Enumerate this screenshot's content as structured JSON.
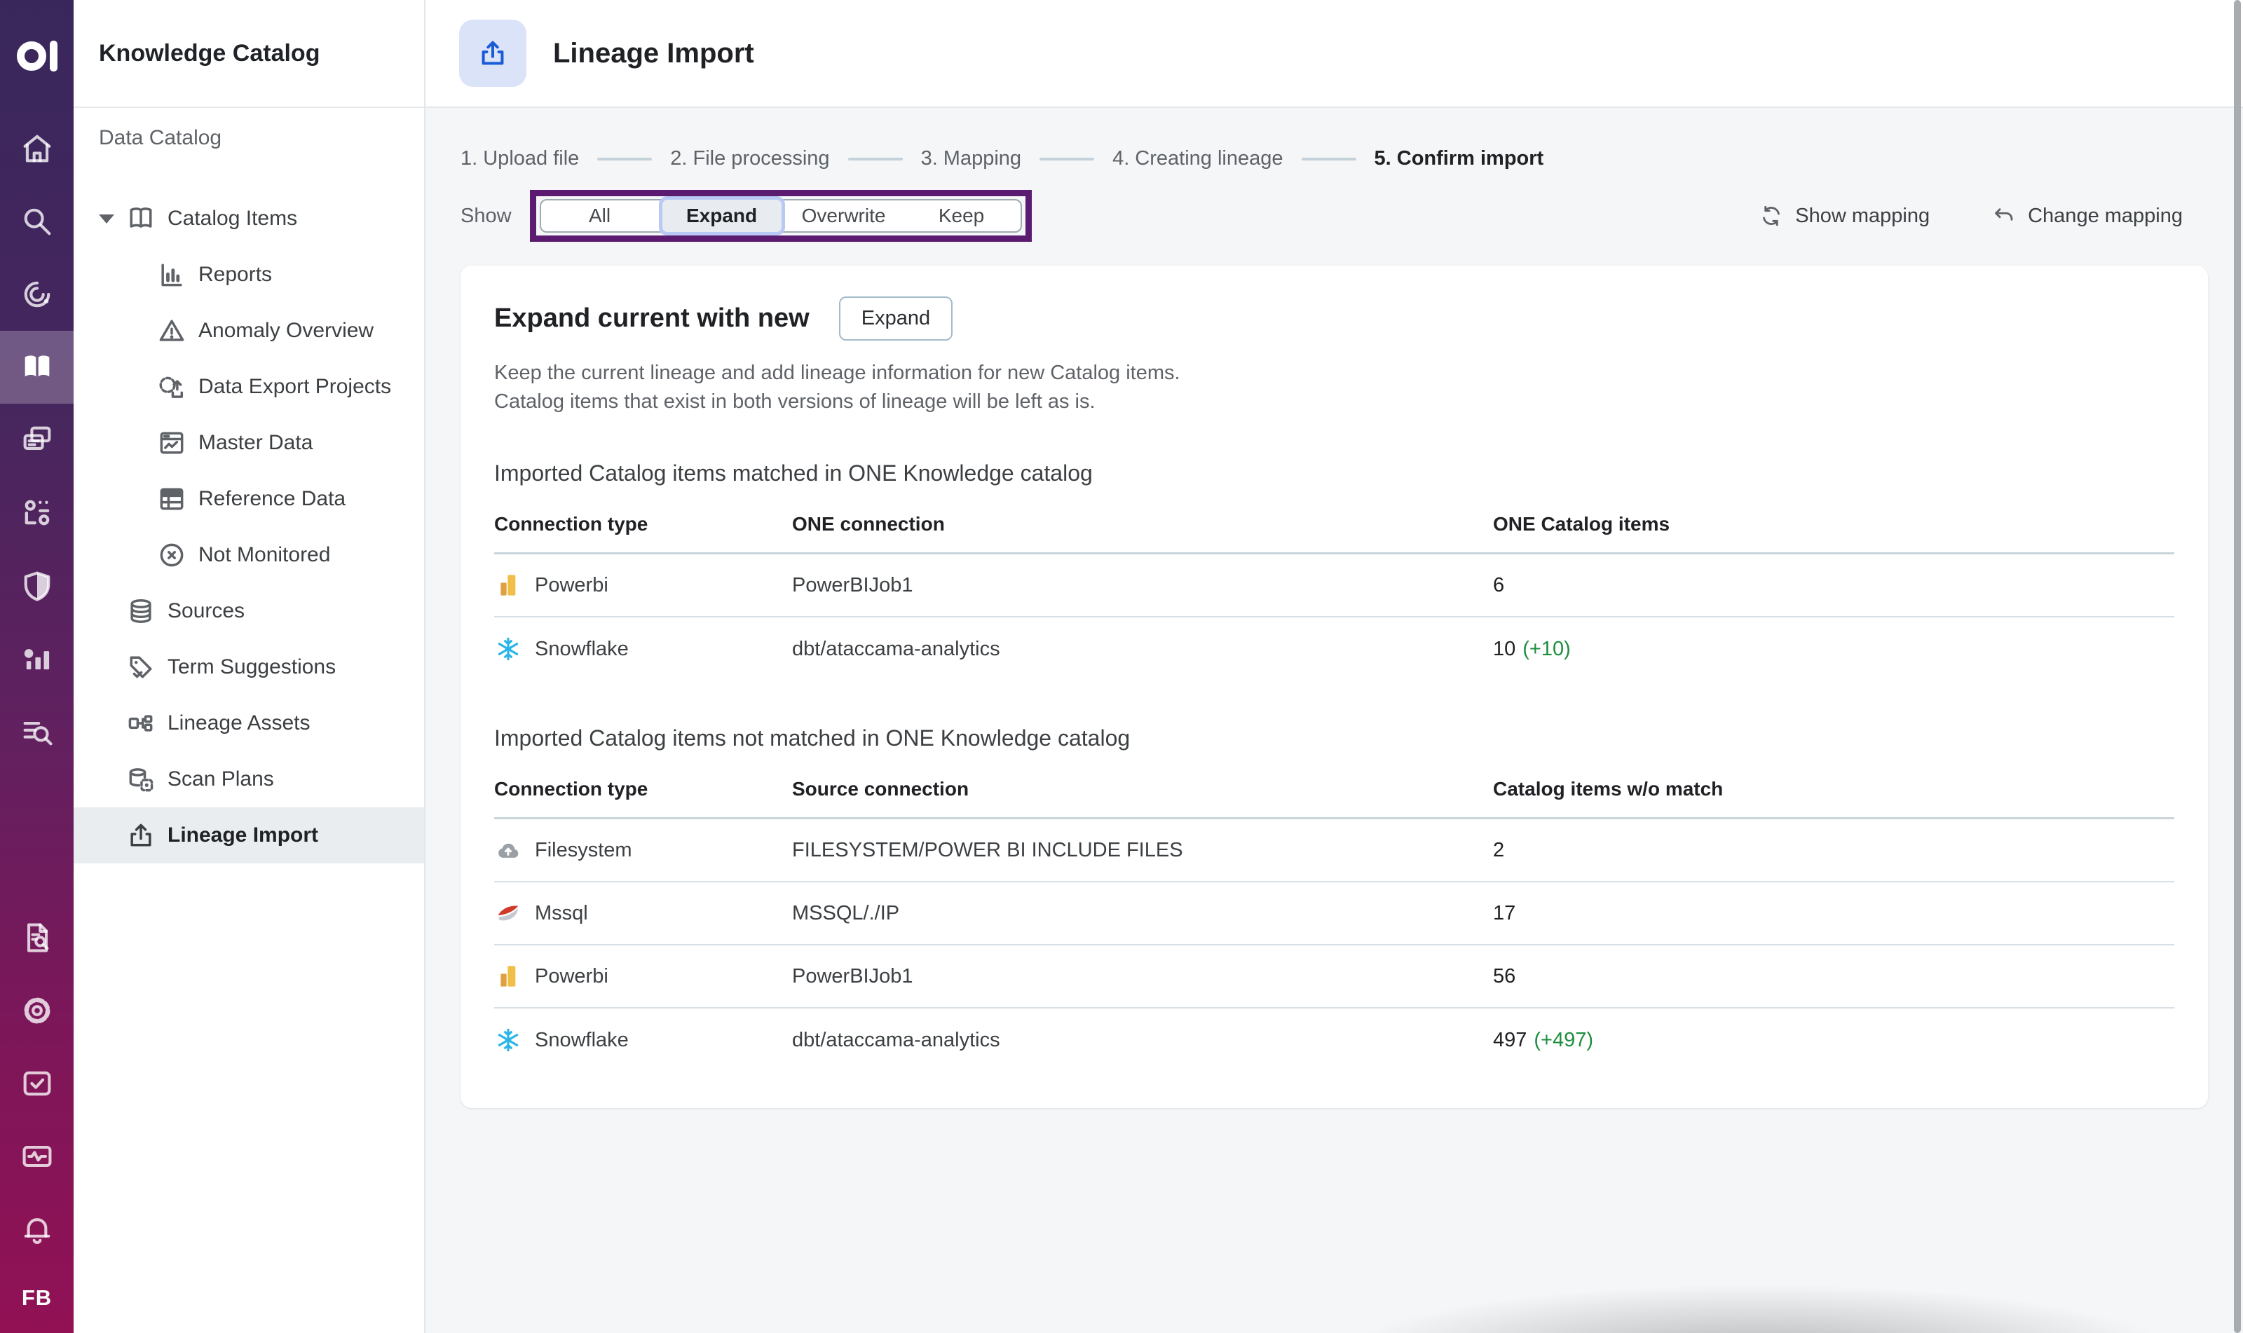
{
  "product": {
    "name": "Knowledge Catalog",
    "avatar": "FB"
  },
  "rail": {
    "items_top": [
      {
        "icon": "home-icon"
      },
      {
        "icon": "search-icon"
      },
      {
        "icon": "data-quality-icon"
      },
      {
        "icon": "knowledge-catalog-icon",
        "active": true
      },
      {
        "icon": "projects-icon"
      },
      {
        "icon": "data-stories-icon"
      },
      {
        "icon": "governance-shield-icon"
      },
      {
        "icon": "insights-icon"
      },
      {
        "icon": "data-discovery-icon"
      }
    ],
    "items_bottom": [
      {
        "icon": "audit-icon"
      },
      {
        "icon": "settings-gear-icon"
      },
      {
        "icon": "tasks-icon"
      },
      {
        "icon": "monitoring-icon"
      },
      {
        "icon": "notifications-bell-icon"
      }
    ]
  },
  "sidebar": {
    "title": "Knowledge Catalog",
    "section": "Data Catalog",
    "items": [
      {
        "label": "Catalog Items",
        "icon": "catalog-items-icon",
        "caret": true
      },
      {
        "label": "Reports",
        "icon": "reports-icon",
        "child": true
      },
      {
        "label": "Anomaly Overview",
        "icon": "anomaly-overview-icon",
        "child": true
      },
      {
        "label": "Data Export Projects",
        "icon": "data-export-projects-icon",
        "child": true
      },
      {
        "label": "Master Data",
        "icon": "master-data-icon",
        "child": true
      },
      {
        "label": "Reference Data",
        "icon": "reference-data-icon",
        "child": true
      },
      {
        "label": "Not Monitored",
        "icon": "not-monitored-icon",
        "child": true
      },
      {
        "label": "Sources",
        "icon": "sources-icon"
      },
      {
        "label": "Term Suggestions",
        "icon": "term-suggestions-icon"
      },
      {
        "label": "Lineage Assets",
        "icon": "lineage-assets-icon"
      },
      {
        "label": "Scan Plans",
        "icon": "scan-plans-icon"
      },
      {
        "label": "Lineage Import",
        "icon": "lineage-import-icon",
        "active": true
      }
    ]
  },
  "header": {
    "title": "Lineage Import"
  },
  "steps": [
    {
      "label": "1. Upload file"
    },
    {
      "label": "2. File processing"
    },
    {
      "label": "3. Mapping"
    },
    {
      "label": "4. Creating lineage"
    },
    {
      "label": "5. Confirm import",
      "active": true
    }
  ],
  "show_filter": {
    "label": "Show",
    "options": [
      {
        "label": "All"
      },
      {
        "label": "Expand",
        "selected": true
      },
      {
        "label": "Overwrite"
      },
      {
        "label": "Keep"
      }
    ]
  },
  "toolbar": {
    "show_mapping": "Show mapping",
    "change_mapping": "Change mapping"
  },
  "panel": {
    "title": "Expand current with new",
    "action": "Expand",
    "description_line1": "Keep the current lineage and add lineage information for new Catalog items.",
    "description_line2": "Catalog items that exist in both versions of lineage will be left as is.",
    "matched": {
      "title": "Imported Catalog items matched in ONE Knowledge catalog",
      "columns": [
        "Connection type",
        "ONE connection",
        "ONE Catalog items"
      ],
      "rows": [
        {
          "icon": "powerbi-icon",
          "type": "Powerbi",
          "connection": "PowerBIJob1",
          "count": "6",
          "delta": ""
        },
        {
          "icon": "snowflake-icon",
          "type": "Snowflake",
          "connection": "dbt/ataccama-analytics",
          "count": "10",
          "delta": "(+10)"
        }
      ]
    },
    "unmatched": {
      "title": "Imported Catalog items not matched in ONE Knowledge catalog",
      "columns": [
        "Connection type",
        "Source connection",
        "Catalog items w/o match"
      ],
      "rows": [
        {
          "icon": "filesystem-icon",
          "type": "Filesystem",
          "connection": "FILESYSTEM/POWER BI INCLUDE FILES",
          "count": "2",
          "delta": ""
        },
        {
          "icon": "mssql-icon",
          "type": "Mssql",
          "connection": "MSSQL/./IP",
          "count": "17",
          "delta": ""
        },
        {
          "icon": "powerbi-icon",
          "type": "Powerbi",
          "connection": "PowerBIJob1",
          "count": "56",
          "delta": ""
        },
        {
          "icon": "snowflake-icon",
          "type": "Snowflake",
          "connection": "dbt/ataccama-analytics",
          "count": "497",
          "delta": "(+497)"
        }
      ]
    }
  },
  "colors": {
    "annotation_purple": "#5a1b70",
    "selected_segment_border": "#b7c9f4",
    "delta_green": "#1e8e3e",
    "brand_blue": "#1a5cd6",
    "rail_gradient_top": "#39275b",
    "rail_gradient_bottom": "#921155",
    "snowflake_blue": "#29b5e8",
    "powerbi_gold": "#f1be48"
  }
}
